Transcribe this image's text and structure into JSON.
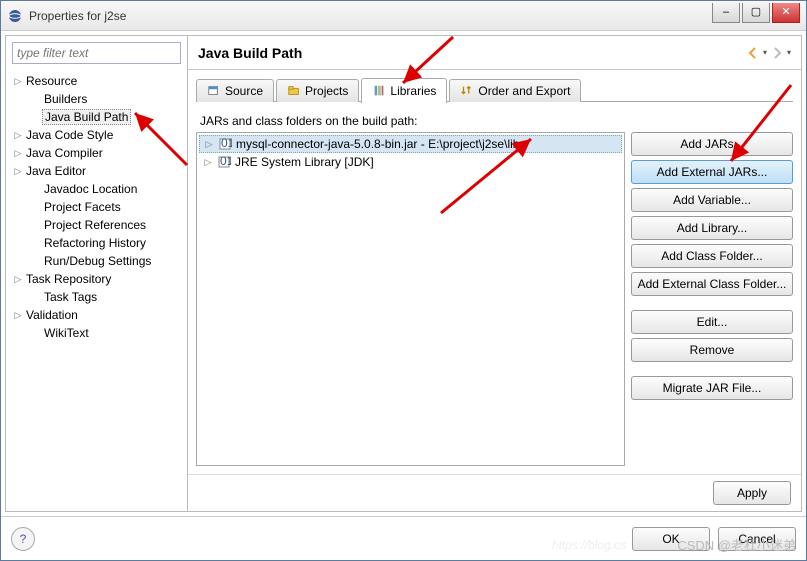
{
  "window": {
    "title": "Properties for j2se"
  },
  "sidebar": {
    "filter_placeholder": "type filter text",
    "items": [
      {
        "label": "Resource",
        "expandable": true
      },
      {
        "label": "Builders",
        "expandable": false,
        "child": true
      },
      {
        "label": "Java Build Path",
        "expandable": false,
        "child": true,
        "selected": true
      },
      {
        "label": "Java Code Style",
        "expandable": true,
        "child": false
      },
      {
        "label": "Java Compiler",
        "expandable": true
      },
      {
        "label": "Java Editor",
        "expandable": true
      },
      {
        "label": "Javadoc Location",
        "expandable": false,
        "child": true
      },
      {
        "label": "Project Facets",
        "expandable": false,
        "child": true
      },
      {
        "label": "Project References",
        "expandable": false,
        "child": true
      },
      {
        "label": "Refactoring History",
        "expandable": false,
        "child": true
      },
      {
        "label": "Run/Debug Settings",
        "expandable": false,
        "child": true
      },
      {
        "label": "Task Repository",
        "expandable": true
      },
      {
        "label": "Task Tags",
        "expandable": false,
        "child": true
      },
      {
        "label": "Validation",
        "expandable": true
      },
      {
        "label": "WikiText",
        "expandable": false,
        "child": true
      }
    ]
  },
  "main": {
    "title": "Java Build Path",
    "tabs": [
      {
        "label": "Source"
      },
      {
        "label": "Projects"
      },
      {
        "label": "Libraries",
        "active": true
      },
      {
        "label": "Order and Export"
      }
    ],
    "desc": "JARs and class folders on the build path:",
    "jars": [
      {
        "label": "mysql-connector-java-5.0.8-bin.jar - E:\\project\\j2se\\lib",
        "selected": true
      },
      {
        "label": "JRE System Library [JDK]"
      }
    ],
    "buttons": {
      "add_jars": "Add JARs...",
      "add_ext_jars": "Add External JARs...",
      "add_var": "Add Variable...",
      "add_lib": "Add Library...",
      "add_cf": "Add Class Folder...",
      "add_ext_cf": "Add External Class Folder...",
      "edit": "Edit...",
      "remove": "Remove",
      "migrate": "Migrate JAR File..."
    },
    "apply": "Apply"
  },
  "footer": {
    "ok": "OK",
    "cancel": "Cancel"
  },
  "watermark": "CSDN @老杜小迷弟"
}
